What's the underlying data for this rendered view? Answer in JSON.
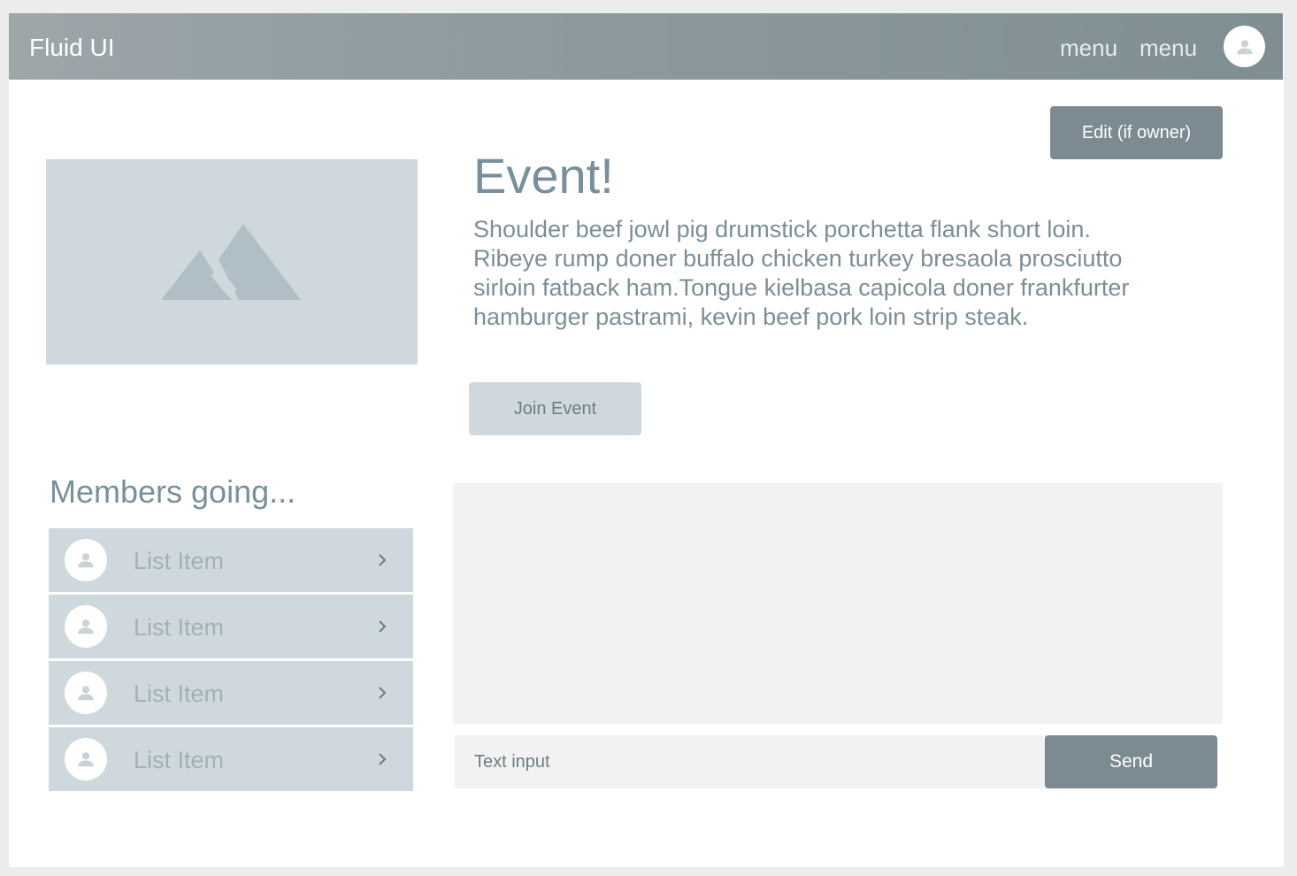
{
  "navbar": {
    "brand": "Fluid UI",
    "menu_items": [
      "menu",
      "menu"
    ],
    "avatar_icon": "user-icon"
  },
  "event": {
    "title": "Event!",
    "description": "Shoulder beef jowl pig drumstick porchetta flank short loin. Ribeye rump doner buffalo chicken turkey bresaola prosciutto sirloin fatback ham.Tongue kielbasa capicola doner frankfurter hamburger pastrami, kevin beef pork loin strip steak.",
    "edit_label": "Edit (if owner)",
    "join_label": "Join Event",
    "image_icon": "image-placeholder-icon"
  },
  "members": {
    "title": "Members going...",
    "items": [
      {
        "label": "List Item"
      },
      {
        "label": "List Item"
      },
      {
        "label": "List Item"
      },
      {
        "label": "List Item"
      }
    ]
  },
  "chat": {
    "input_placeholder": "Text input",
    "send_label": "Send"
  },
  "colors": {
    "primary": "#7c8b91",
    "light": "#cfd8dc",
    "text": "#78909c"
  }
}
